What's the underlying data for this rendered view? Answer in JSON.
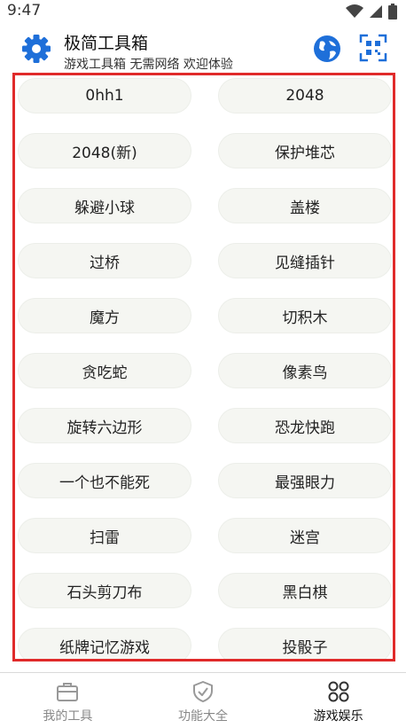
{
  "status": {
    "time": "9:47"
  },
  "header": {
    "title": "极简工具箱",
    "subtitle": "游戏工具箱 无需网络 欢迎体验"
  },
  "games": [
    "0hh1",
    "2048",
    "2048(新)",
    "保护堆芯",
    "躲避小球",
    "盖楼",
    "过桥",
    "见缝插针",
    "魔方",
    "切积木",
    "贪吃蛇",
    "像素鸟",
    "旋转六边形",
    "恐龙快跑",
    "一个也不能死",
    "最强眼力",
    "扫雷",
    "迷宫",
    "石头剪刀布",
    "黑白棋",
    "纸牌记忆游戏",
    "投骰子"
  ],
  "nav": [
    {
      "label": "我的工具",
      "icon": "toolbox-icon",
      "active": false
    },
    {
      "label": "功能大全",
      "icon": "shield-check-icon",
      "active": false
    },
    {
      "label": "游戏娱乐",
      "icon": "grid-circles-icon",
      "active": true
    }
  ],
  "colors": {
    "accent": "#1e6fd9",
    "highlight_border": "#e02a2a",
    "button_bg": "#f5f6f2"
  }
}
